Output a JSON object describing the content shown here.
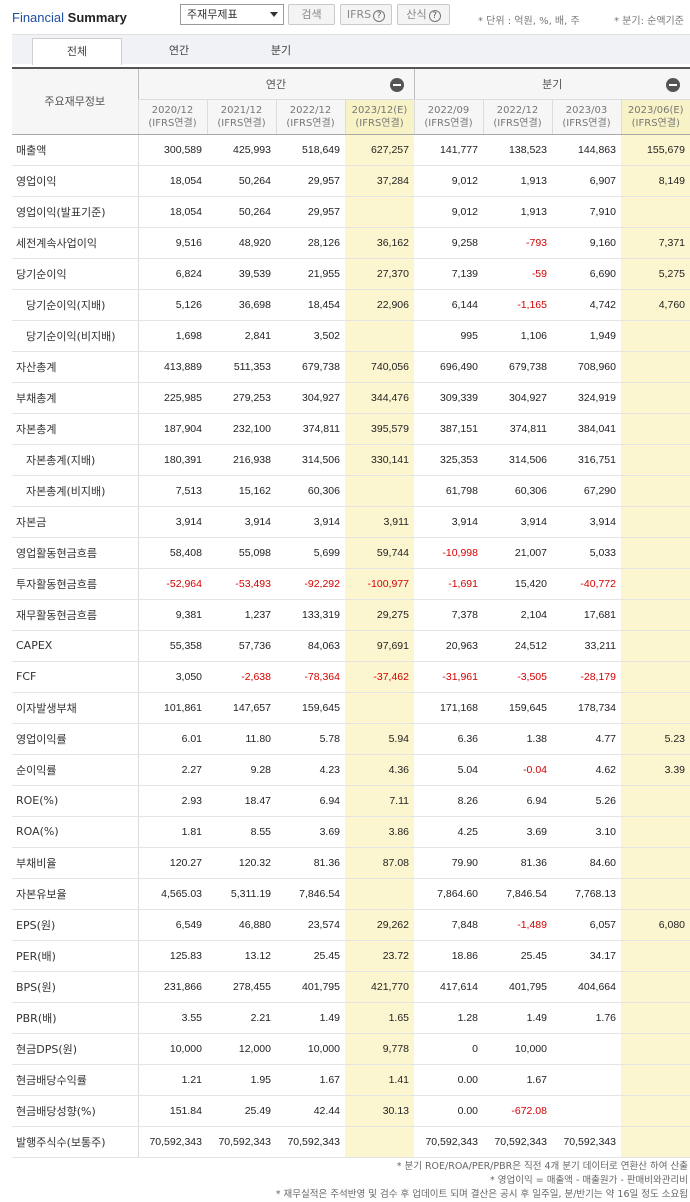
{
  "header": {
    "title_part1": "Financial",
    "title_part2": "Summary",
    "select_value": "주재무제표",
    "search_button": "검색",
    "ifrs_button": "IFRS",
    "formula_button": "산식",
    "unit_text": "* 단위 : 억원, %, 배, 주",
    "period_text": "* 분기: 순액기준"
  },
  "tabs": [
    "전체",
    "연간",
    "분기"
  ],
  "table": {
    "corner_label": "주요재무정보",
    "group_annual": "연간",
    "group_quarter": "분기",
    "columns": [
      {
        "date": "2020/12",
        "basis": "(IFRS연결)",
        "est": false
      },
      {
        "date": "2021/12",
        "basis": "(IFRS연결)",
        "est": false
      },
      {
        "date": "2022/12",
        "basis": "(IFRS연결)",
        "est": false
      },
      {
        "date": "2023/12(E)",
        "basis": "(IFRS연결)",
        "est": true
      },
      {
        "date": "2022/09",
        "basis": "(IFRS연결)",
        "est": false
      },
      {
        "date": "2022/12",
        "basis": "(IFRS연결)",
        "est": false
      },
      {
        "date": "2023/03",
        "basis": "(IFRS연결)",
        "est": false
      },
      {
        "date": "2023/06(E)",
        "basis": "(IFRS연결)",
        "est": true
      }
    ],
    "rows": [
      {
        "label": "매출액",
        "sub": false,
        "values": [
          "300,589",
          "425,993",
          "518,649",
          "627,257",
          "141,777",
          "138,523",
          "144,863",
          "155,679"
        ]
      },
      {
        "label": "영업이익",
        "sub": false,
        "values": [
          "18,054",
          "50,264",
          "29,957",
          "37,284",
          "9,012",
          "1,913",
          "6,907",
          "8,149"
        ]
      },
      {
        "label": "영업이익(발표기준)",
        "sub": false,
        "values": [
          "18,054",
          "50,264",
          "29,957",
          "",
          "9,012",
          "1,913",
          "7,910",
          ""
        ]
      },
      {
        "label": "세전계속사업이익",
        "sub": false,
        "values": [
          "9,516",
          "48,920",
          "28,126",
          "36,162",
          "9,258",
          "-793",
          "9,160",
          "7,371"
        ]
      },
      {
        "label": "당기순이익",
        "sub": false,
        "values": [
          "6,824",
          "39,539",
          "21,955",
          "27,370",
          "7,139",
          "-59",
          "6,690",
          "5,275"
        ]
      },
      {
        "label": "당기순이익(지배)",
        "sub": true,
        "values": [
          "5,126",
          "36,698",
          "18,454",
          "22,906",
          "6,144",
          "-1,165",
          "4,742",
          "4,760"
        ]
      },
      {
        "label": "당기순이익(비지배)",
        "sub": true,
        "values": [
          "1,698",
          "2,841",
          "3,502",
          "",
          "995",
          "1,106",
          "1,949",
          ""
        ]
      },
      {
        "label": "자산총계",
        "sub": false,
        "values": [
          "413,889",
          "511,353",
          "679,738",
          "740,056",
          "696,490",
          "679,738",
          "708,960",
          ""
        ]
      },
      {
        "label": "부채총계",
        "sub": false,
        "values": [
          "225,985",
          "279,253",
          "304,927",
          "344,476",
          "309,339",
          "304,927",
          "324,919",
          ""
        ]
      },
      {
        "label": "자본총계",
        "sub": false,
        "values": [
          "187,904",
          "232,100",
          "374,811",
          "395,579",
          "387,151",
          "374,811",
          "384,041",
          ""
        ]
      },
      {
        "label": "자본총계(지배)",
        "sub": true,
        "values": [
          "180,391",
          "216,938",
          "314,506",
          "330,141",
          "325,353",
          "314,506",
          "316,751",
          ""
        ]
      },
      {
        "label": "자본총계(비지배)",
        "sub": true,
        "values": [
          "7,513",
          "15,162",
          "60,306",
          "",
          "61,798",
          "60,306",
          "67,290",
          ""
        ]
      },
      {
        "label": "자본금",
        "sub": false,
        "values": [
          "3,914",
          "3,914",
          "3,914",
          "3,911",
          "3,914",
          "3,914",
          "3,914",
          ""
        ]
      },
      {
        "label": "영업활동현금흐름",
        "sub": false,
        "values": [
          "58,408",
          "55,098",
          "5,699",
          "59,744",
          "-10,998",
          "21,007",
          "5,033",
          ""
        ]
      },
      {
        "label": "투자활동현금흐름",
        "sub": false,
        "values": [
          "-52,964",
          "-53,493",
          "-92,292",
          "-100,977",
          "-1,691",
          "15,420",
          "-40,772",
          ""
        ]
      },
      {
        "label": "재무활동현금흐름",
        "sub": false,
        "values": [
          "9,381",
          "1,237",
          "133,319",
          "29,275",
          "7,378",
          "2,104",
          "17,681",
          ""
        ]
      },
      {
        "label": "CAPEX",
        "sub": false,
        "values": [
          "55,358",
          "57,736",
          "84,063",
          "97,691",
          "20,963",
          "24,512",
          "33,211",
          ""
        ]
      },
      {
        "label": "FCF",
        "sub": false,
        "values": [
          "3,050",
          "-2,638",
          "-78,364",
          "-37,462",
          "-31,961",
          "-3,505",
          "-28,179",
          ""
        ]
      },
      {
        "label": "이자발생부채",
        "sub": false,
        "values": [
          "101,861",
          "147,657",
          "159,645",
          "",
          "171,168",
          "159,645",
          "178,734",
          ""
        ]
      },
      {
        "label": "영업이익률",
        "sub": false,
        "values": [
          "6.01",
          "11.80",
          "5.78",
          "5.94",
          "6.36",
          "1.38",
          "4.77",
          "5.23"
        ]
      },
      {
        "label": "순이익률",
        "sub": false,
        "values": [
          "2.27",
          "9.28",
          "4.23",
          "4.36",
          "5.04",
          "-0.04",
          "4.62",
          "3.39"
        ]
      },
      {
        "label": "ROE(%)",
        "sub": false,
        "values": [
          "2.93",
          "18.47",
          "6.94",
          "7.11",
          "8.26",
          "6.94",
          "5.26",
          ""
        ]
      },
      {
        "label": "ROA(%)",
        "sub": false,
        "values": [
          "1.81",
          "8.55",
          "3.69",
          "3.86",
          "4.25",
          "3.69",
          "3.10",
          ""
        ]
      },
      {
        "label": "부채비율",
        "sub": false,
        "values": [
          "120.27",
          "120.32",
          "81.36",
          "87.08",
          "79.90",
          "81.36",
          "84.60",
          ""
        ]
      },
      {
        "label": "자본유보율",
        "sub": false,
        "values": [
          "4,565.03",
          "5,311.19",
          "7,846.54",
          "",
          "7,864.60",
          "7,846.54",
          "7,768.13",
          ""
        ]
      },
      {
        "label": "EPS(원)",
        "sub": false,
        "values": [
          "6,549",
          "46,880",
          "23,574",
          "29,262",
          "7,848",
          "-1,489",
          "6,057",
          "6,080"
        ]
      },
      {
        "label": "PER(배)",
        "sub": false,
        "values": [
          "125.83",
          "13.12",
          "25.45",
          "23.72",
          "18.86",
          "25.45",
          "34.17",
          ""
        ]
      },
      {
        "label": "BPS(원)",
        "sub": false,
        "values": [
          "231,866",
          "278,455",
          "401,795",
          "421,770",
          "417,614",
          "401,795",
          "404,664",
          ""
        ]
      },
      {
        "label": "PBR(배)",
        "sub": false,
        "values": [
          "3.55",
          "2.21",
          "1.49",
          "1.65",
          "1.28",
          "1.49",
          "1.76",
          ""
        ]
      },
      {
        "label": "현금DPS(원)",
        "sub": false,
        "values": [
          "10,000",
          "12,000",
          "10,000",
          "9,778",
          "0",
          "10,000",
          "",
          ""
        ]
      },
      {
        "label": "현금배당수익률",
        "sub": false,
        "values": [
          "1.21",
          "1.95",
          "1.67",
          "1.41",
          "0.00",
          "1.67",
          "",
          ""
        ]
      },
      {
        "label": "현금배당성향(%)",
        "sub": false,
        "values": [
          "151.84",
          "25.49",
          "42.44",
          "30.13",
          "0.00",
          "-672.08",
          "",
          ""
        ]
      },
      {
        "label": "발행주식수(보통주)",
        "sub": false,
        "values": [
          "70,592,343",
          "70,592,343",
          "70,592,343",
          "",
          "70,592,343",
          "70,592,343",
          "70,592,343",
          ""
        ]
      }
    ]
  },
  "footnotes": [
    "* 분기 ROE/ROA/PER/PBR은 직전 4개 분기 데이터로 연환산 하여 산출",
    "* 영업이익 = 매출액 - 매출원가 - 판매비와관리비",
    "* 재무실적은 주석반영 및 검수 후 업데이트 되며 결산은 공시 후 일주일, 분/반기는 약 16일 정도 소요됩"
  ],
  "colors": {
    "estimate_bg": "#fbf6d0",
    "negative": "#d40000",
    "title_blue": "#1f4fa3"
  }
}
